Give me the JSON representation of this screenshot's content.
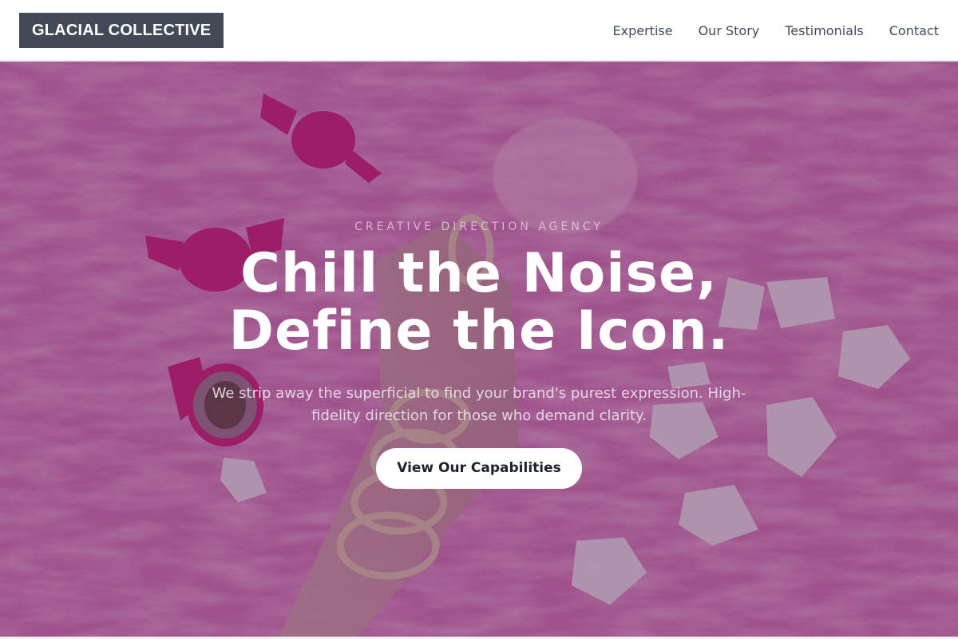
{
  "header": {
    "logo": "GLACIAL COLLECTIVE",
    "nav": [
      {
        "label": "Expertise"
      },
      {
        "label": "Our Story"
      },
      {
        "label": "Testimonials"
      },
      {
        "label": "Contact"
      }
    ]
  },
  "hero": {
    "eyebrow": "CREATIVE DIRECTION AGENCY",
    "headline_line1": "Chill the Noise,",
    "headline_line2": "Define the Icon.",
    "subtext": "We strip away the superficial to find your brand's purest expression. High-fidelity direction for those who demand clarity.",
    "cta_label": "View Our Capabilities",
    "background_image": "fluffy pink rug with candies, cocktail glass, hand with gold chain bracelets and white petals"
  },
  "colors": {
    "logo_bg": "#414a56",
    "overlay": "#5c2a5c",
    "nav_text": "#434c5a",
    "cta_bg": "#ffffff",
    "cta_text": "#1c2230"
  }
}
